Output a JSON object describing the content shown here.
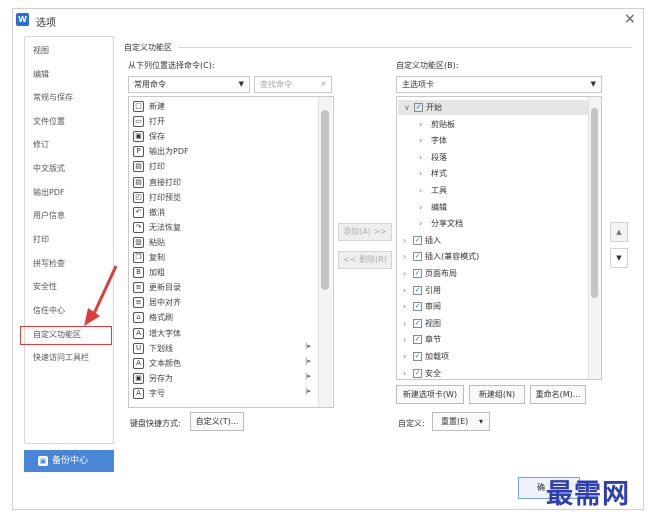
{
  "window": {
    "title": "选项",
    "close_glyph": "×"
  },
  "sidebar": {
    "items": [
      {
        "label": "视图"
      },
      {
        "label": "编辑"
      },
      {
        "label": "常规与保存"
      },
      {
        "label": "文件位置"
      },
      {
        "label": "修订"
      },
      {
        "label": "中文版式"
      },
      {
        "label": "输出PDF"
      },
      {
        "label": "用户信息"
      },
      {
        "label": "打印"
      },
      {
        "label": "拼写检查"
      },
      {
        "label": "安全性"
      },
      {
        "label": "信任中心"
      },
      {
        "label": "自定义功能区"
      },
      {
        "label": "快速访问工具栏"
      }
    ],
    "selected": "自定义功能区",
    "backup_label": "备份中心"
  },
  "section": {
    "title": "自定义功能区"
  },
  "left": {
    "label": "从下列位置选择命令(C):",
    "combo_value": "常用命令",
    "search_placeholder": "查找命令",
    "commands": [
      {
        "label": "新建",
        "icon": "new-icon",
        "glyph": "□"
      },
      {
        "label": "打开",
        "icon": "open-folder-icon",
        "glyph": "▭"
      },
      {
        "label": "保存",
        "icon": "save-icon",
        "glyph": "▣"
      },
      {
        "label": "输出为PDF",
        "icon": "pdf-icon",
        "glyph": "P"
      },
      {
        "label": "打印",
        "icon": "print-icon",
        "glyph": "▤"
      },
      {
        "label": "直接打印",
        "icon": "direct-print-icon",
        "glyph": "▤"
      },
      {
        "label": "打印预览",
        "icon": "print-preview-icon",
        "glyph": "◰"
      },
      {
        "label": "撤消",
        "icon": "undo-icon",
        "glyph": "↶"
      },
      {
        "label": "无法恢复",
        "icon": "redo-icon",
        "glyph": "↷"
      },
      {
        "label": "粘贴",
        "icon": "paste-icon",
        "glyph": "▥"
      },
      {
        "label": "复制",
        "icon": "copy-icon",
        "glyph": "❐"
      },
      {
        "label": "加粗",
        "icon": "bold-icon",
        "glyph": "B"
      },
      {
        "label": "更新目录",
        "icon": "update-toc-icon",
        "glyph": "≡"
      },
      {
        "label": "居中对齐",
        "icon": "align-center-icon",
        "glyph": "≡"
      },
      {
        "label": "格式刷",
        "icon": "format-painter-icon",
        "glyph": "⌂"
      },
      {
        "label": "增大字体",
        "icon": "increase-font-icon",
        "glyph": "A"
      },
      {
        "label": "下划线",
        "icon": "underline-icon",
        "glyph": "U"
      },
      {
        "label": "文本颜色",
        "icon": "text-color-icon",
        "glyph": "A"
      },
      {
        "label": "另存为",
        "icon": "save-as-icon",
        "glyph": "▣"
      },
      {
        "label": "字号",
        "icon": "font-size-icon",
        "glyph": "A"
      }
    ],
    "submenu_glyph": "|▸"
  },
  "middle": {
    "add_label": "添加(A) >>",
    "remove_label": "<< 删除(R)"
  },
  "right": {
    "label": "自定义功能区(B):",
    "combo_value": "主选项卡",
    "tree": [
      {
        "label": "开始",
        "level": 0,
        "toggle": "∨",
        "checked": true,
        "selected": true
      },
      {
        "label": "剪贴板",
        "level": 1,
        "toggle": "›",
        "checked": false
      },
      {
        "label": "字体",
        "level": 1,
        "toggle": "›",
        "checked": false
      },
      {
        "label": "段落",
        "level": 1,
        "toggle": "›",
        "checked": false
      },
      {
        "label": "样式",
        "level": 1,
        "toggle": "›",
        "checked": false
      },
      {
        "label": "工具",
        "level": 1,
        "toggle": "›",
        "checked": false
      },
      {
        "label": "编辑",
        "level": 1,
        "toggle": "›",
        "checked": false
      },
      {
        "label": "分享文档",
        "level": 1,
        "toggle": "›",
        "checked": false
      },
      {
        "label": "插入",
        "level": 0,
        "toggle": "›",
        "checked": true
      },
      {
        "label": "插入(兼容模式)",
        "level": 0,
        "toggle": "›",
        "checked": true
      },
      {
        "label": "页面布局",
        "level": 0,
        "toggle": "›",
        "checked": true
      },
      {
        "label": "引用",
        "level": 0,
        "toggle": "›",
        "checked": true
      },
      {
        "label": "审阅",
        "level": 0,
        "toggle": "›",
        "checked": true
      },
      {
        "label": "视图",
        "level": 0,
        "toggle": "›",
        "checked": true
      },
      {
        "label": "章节",
        "level": 0,
        "toggle": "›",
        "checked": true
      },
      {
        "label": "加载项",
        "level": 0,
        "toggle": "›",
        "checked": true
      },
      {
        "label": "安全",
        "level": 0,
        "toggle": "›",
        "checked": true
      }
    ],
    "new_tab_label": "新建选项卡(W)",
    "new_group_label": "新建组(N)",
    "rename_label": "重命名(M)...",
    "custom_label": "自定义:",
    "reset_label": "重置(E)"
  },
  "keyboard": {
    "label": "键盘快捷方式:",
    "button_label": "自定义(T)..."
  },
  "ok_label": "确",
  "watermark": "最需网",
  "colors": {
    "accent": "#4a86d8",
    "highlight": "#e03c3c",
    "watermark": "#2f3fb3"
  }
}
